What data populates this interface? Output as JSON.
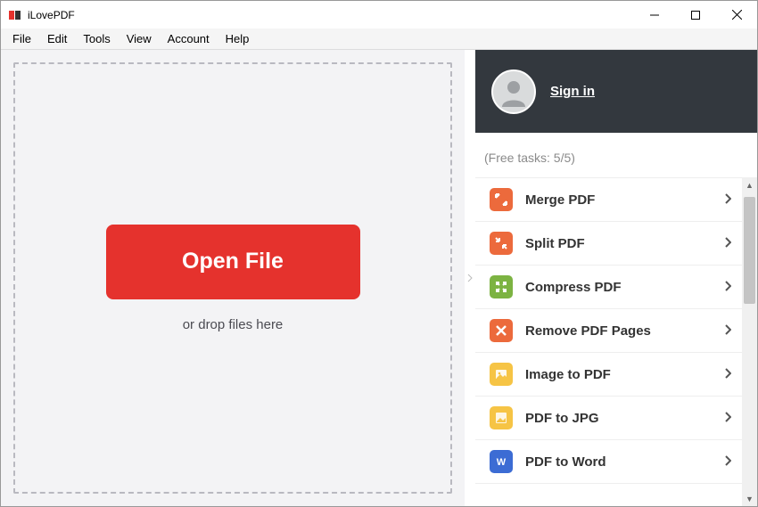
{
  "window": {
    "title": "iLovePDF"
  },
  "menu": {
    "items": [
      "File",
      "Edit",
      "Tools",
      "View",
      "Account",
      "Help"
    ]
  },
  "drop": {
    "open_label": "Open File",
    "hint": "or drop files here"
  },
  "sidebar": {
    "signin_label": "Sign in",
    "quota_text": "(Free tasks: 5/5)",
    "tools": [
      {
        "id": "merge",
        "label": "Merge PDF",
        "icon": "merge-icon",
        "iconClass": "ic-orange"
      },
      {
        "id": "split",
        "label": "Split PDF",
        "icon": "split-icon",
        "iconClass": "ic-orange"
      },
      {
        "id": "compress",
        "label": "Compress PDF",
        "icon": "compress-icon",
        "iconClass": "ic-green"
      },
      {
        "id": "remove",
        "label": "Remove PDF Pages",
        "icon": "remove-icon",
        "iconClass": "ic-orange"
      },
      {
        "id": "img2pdf",
        "label": "Image to PDF",
        "icon": "image-icon",
        "iconClass": "ic-yellow"
      },
      {
        "id": "pdf2jpg",
        "label": "PDF to JPG",
        "icon": "jpg-icon",
        "iconClass": "ic-yellow"
      },
      {
        "id": "pdf2word",
        "label": "PDF to Word",
        "icon": "word-icon",
        "iconClass": "ic-blue"
      }
    ]
  }
}
